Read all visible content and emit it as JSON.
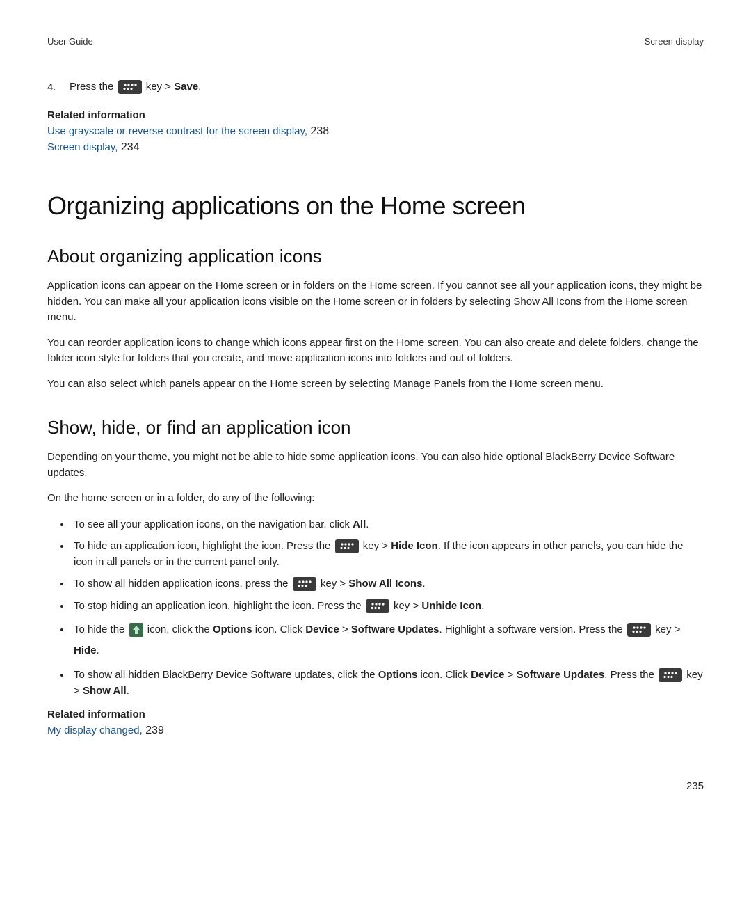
{
  "header": {
    "left": "User Guide",
    "right": "Screen display"
  },
  "step4": {
    "num": "4.",
    "pre": "Press the ",
    "post": " key > ",
    "action": "Save",
    "end": "."
  },
  "related1": {
    "heading": "Related information",
    "items": [
      {
        "label": "Use grayscale or reverse contrast for the screen display,",
        "page": " 238"
      },
      {
        "label": "Screen display,",
        "page": " 234"
      }
    ]
  },
  "h1": "Organizing applications on the Home screen",
  "sectionA": {
    "h2": "About organizing application icons",
    "p1": "Application icons can appear on the Home screen or in folders on the Home screen. If you cannot see all your application icons, they might be hidden. You can make all your application icons visible on the Home screen or in folders by selecting Show All Icons from the Home screen menu.",
    "p2": "You can reorder application icons to change which icons appear first on the Home screen. You can also create and delete folders, change the folder icon style for folders that you create, and move application icons into folders and out of folders.",
    "p3": "You can also select which panels appear on the Home screen by selecting Manage Panels from the Home screen menu."
  },
  "sectionB": {
    "h2": "Show, hide, or find an application icon",
    "intro1": "Depending on your theme, you might not be able to hide some application icons. You can also hide optional BlackBerry Device Software updates.",
    "intro2": "On the home screen or in a folder, do any of the following:",
    "bullets": {
      "b1": {
        "pre": "To see all your application icons, on the navigation bar, click ",
        "bold": "All",
        "post": "."
      },
      "b2": {
        "pre": "To hide an application icon, highlight the icon. Press the ",
        "post1": " key > ",
        "bold": "Hide Icon",
        "post2": ". If the icon appears in other panels, you can hide the icon in all panels or in the current panel only."
      },
      "b3": {
        "pre": "To show all hidden application icons, press the ",
        "post1": " key > ",
        "bold": "Show All Icons",
        "post2": "."
      },
      "b4": {
        "pre": "To stop hiding an application icon, highlight the icon. Press the ",
        "post1": " key > ",
        "bold": "Unhide Icon",
        "post2": "."
      },
      "b5": {
        "pre": "To hide the ",
        "post1": " icon, click the ",
        "bold1": "Options",
        "post2": " icon. Click ",
        "bold2": "Device",
        "gt1": " > ",
        "bold3": "Software Updates",
        "post3": ". Highlight a software version. Press the ",
        "post4": " key > ",
        "bold4": "Hide",
        "post5": "."
      },
      "b6": {
        "pre": "To show all hidden BlackBerry Device Software updates, click the ",
        "bold1": "Options",
        "post1": " icon. Click ",
        "bold2": "Device",
        "gt1": " > ",
        "bold3": "Software Updates",
        "post2": ". Press the ",
        "post3": " key > ",
        "bold4": "Show All",
        "post4": "."
      }
    }
  },
  "related2": {
    "heading": "Related information",
    "items": [
      {
        "label": "My display changed,",
        "page": " 239"
      }
    ]
  },
  "pageNum": "235"
}
